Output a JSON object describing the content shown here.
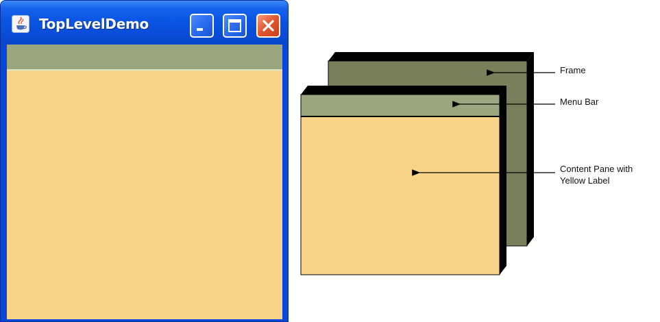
{
  "window": {
    "title": "TopLevelDemo",
    "app_icon": "java-cup-icon",
    "buttons": [
      {
        "name": "minimize",
        "icon": "minimize-icon"
      },
      {
        "name": "maximize",
        "icon": "maximize-icon"
      },
      {
        "name": "close",
        "icon": "close-icon"
      }
    ]
  },
  "diagram": {
    "labels": {
      "frame": "Frame",
      "menu_bar": "Menu Bar",
      "content_pane": "Content Pane with\nYellow Label"
    }
  },
  "colors": {
    "title_bar": "#0b55e4",
    "menu_bar": "#9ba57e",
    "content_pane": "#f8d488",
    "frame": "#7a7f5b",
    "close_button": "#e2552e"
  }
}
